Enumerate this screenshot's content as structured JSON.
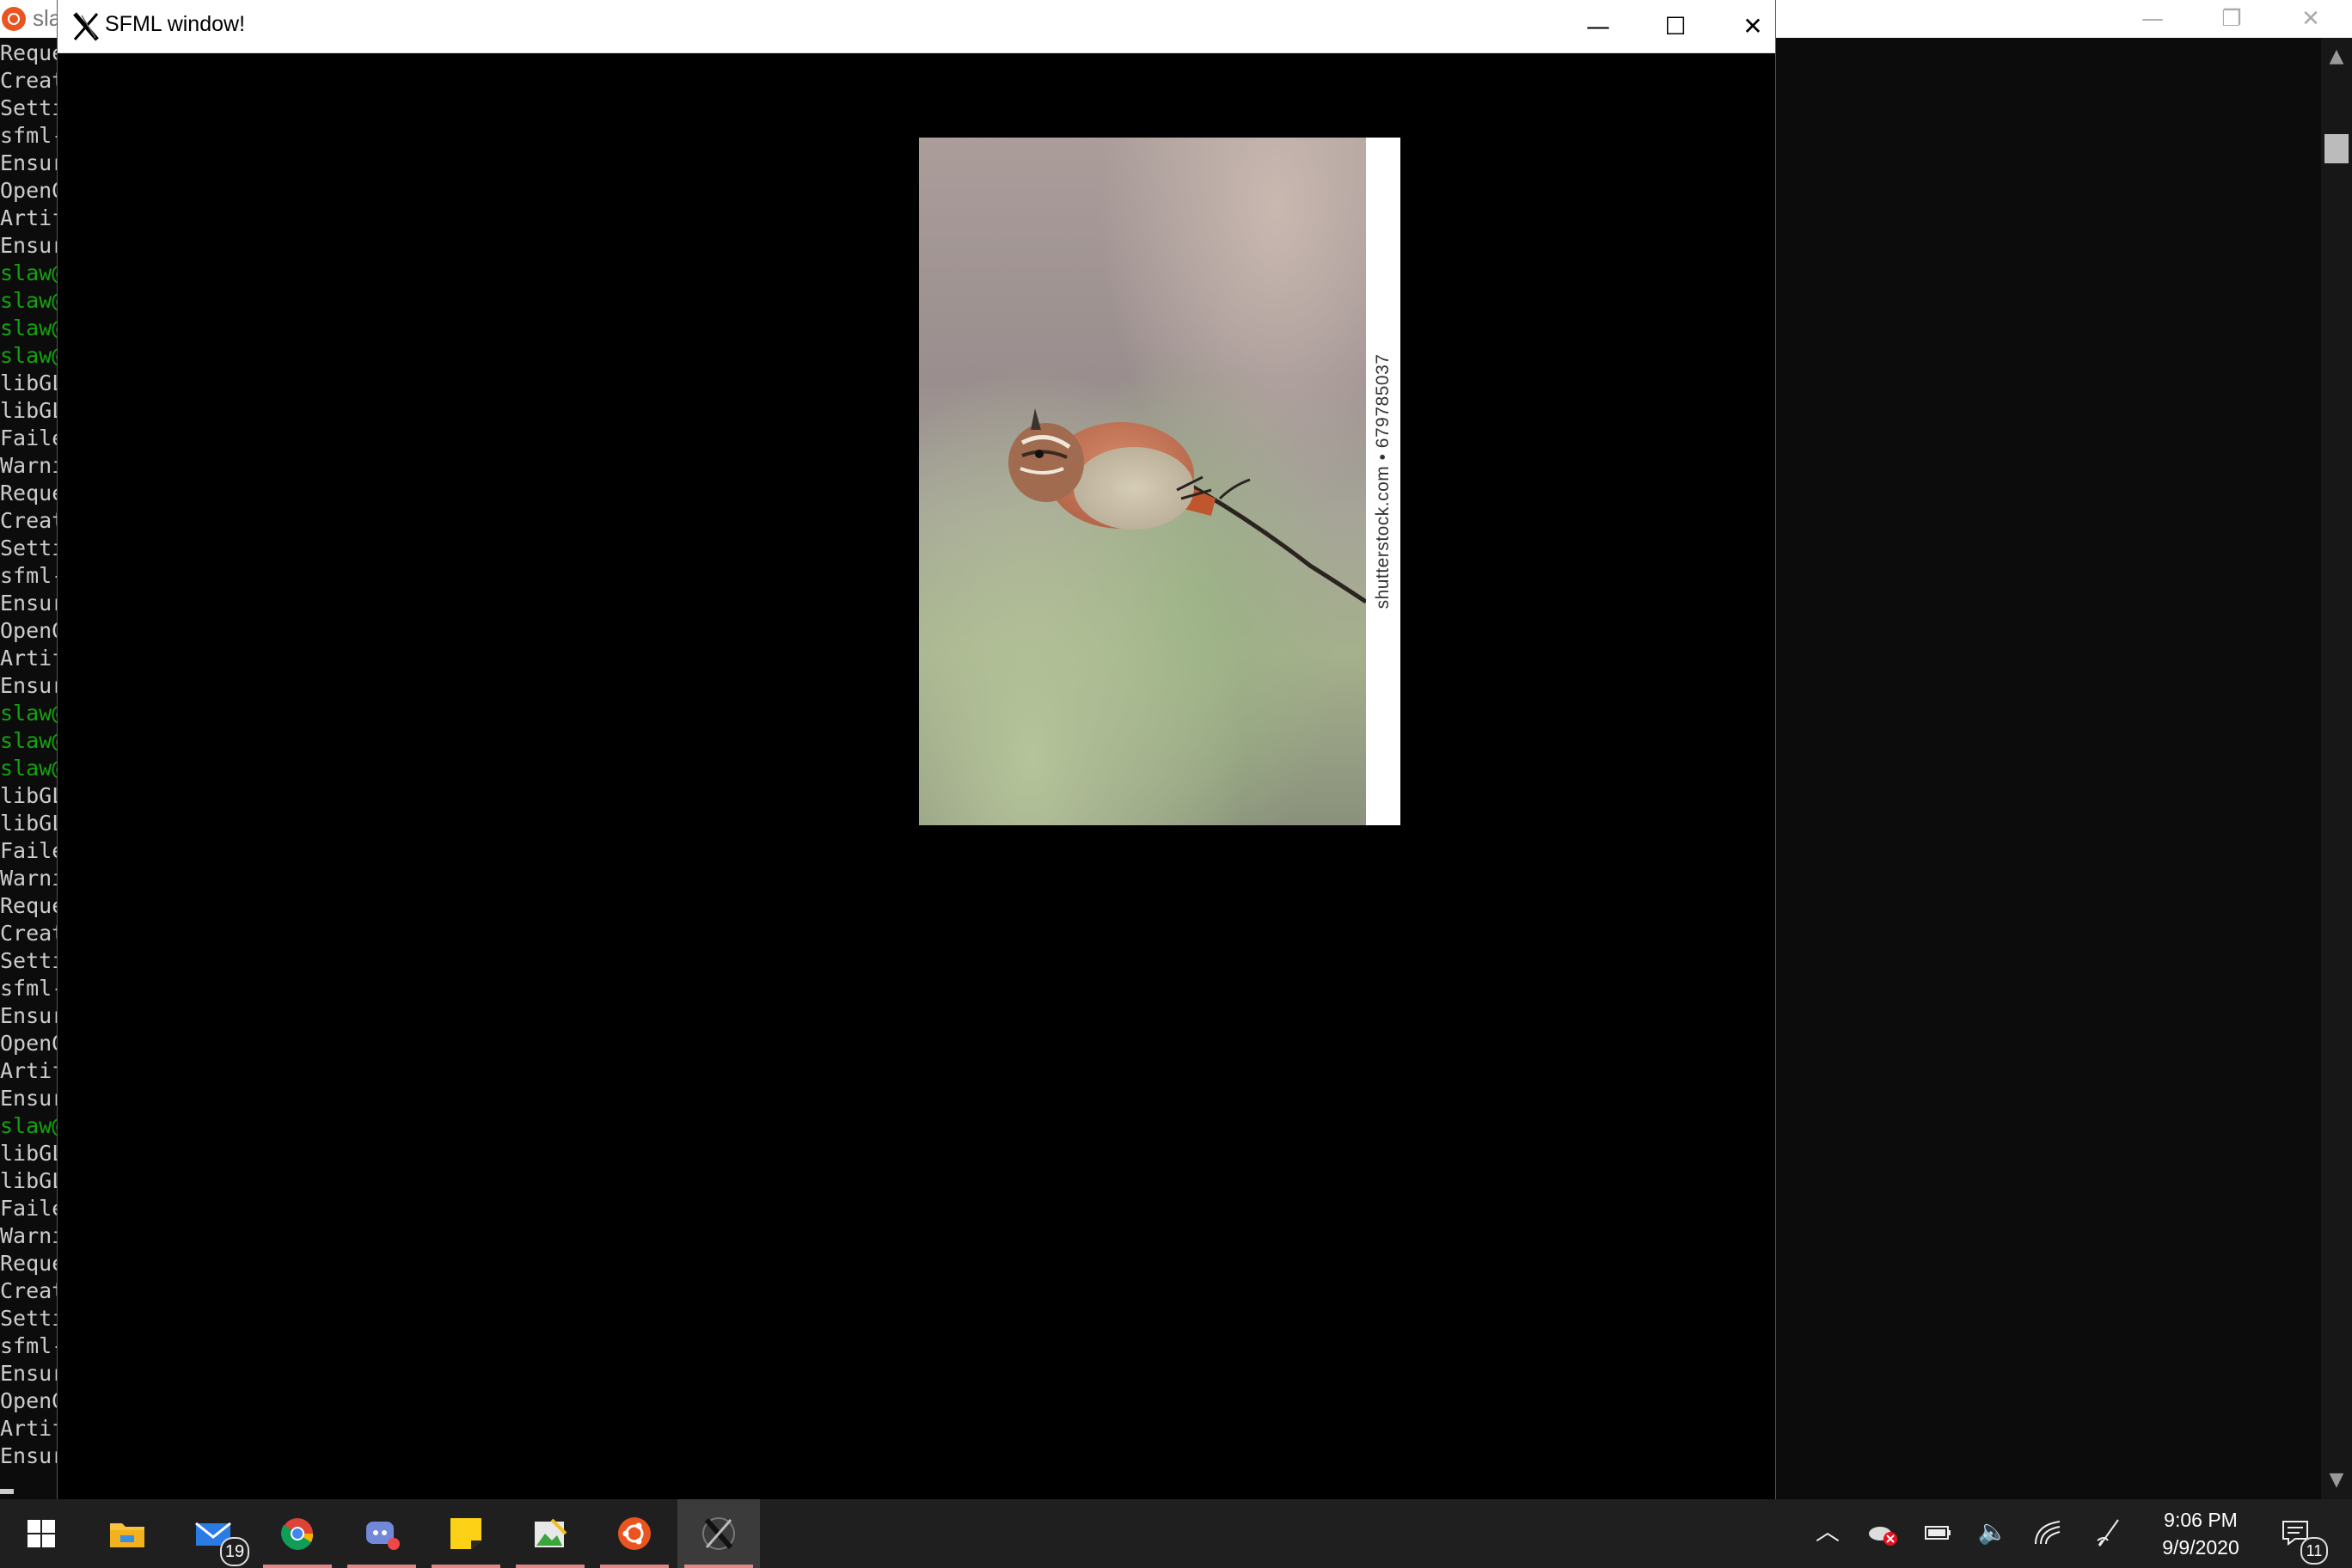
{
  "terminal": {
    "title": "sla",
    "controls": {
      "minimize": "—",
      "restore": "❐",
      "close": "✕"
    },
    "lines": [
      {
        "text": "Reque",
        "green": false
      },
      {
        "text": "Creat",
        "green": false
      },
      {
        "text": "Setti",
        "green": false
      },
      {
        "text": "sfml-",
        "green": false
      },
      {
        "text": "Ensur",
        "green": false
      },
      {
        "text": "OpenG",
        "green": false
      },
      {
        "text": "Artif",
        "green": false
      },
      {
        "text": "Ensur",
        "green": false
      },
      {
        "text": "slaw@",
        "green": true
      },
      {
        "text": "slaw@",
        "green": true
      },
      {
        "text": "slaw@",
        "green": true
      },
      {
        "text": "slaw@",
        "green": true
      },
      {
        "text": "libGL",
        "green": false
      },
      {
        "text": "libGL",
        "green": false
      },
      {
        "text": "Faile",
        "green": false
      },
      {
        "text": "Warni",
        "green": false
      },
      {
        "text": "Reque",
        "green": false
      },
      {
        "text": "Creat",
        "green": false
      },
      {
        "text": "Setti",
        "green": false
      },
      {
        "text": "sfml-",
        "green": false
      },
      {
        "text": "Ensur",
        "green": false
      },
      {
        "text": "OpenG",
        "green": false
      },
      {
        "text": "Artif",
        "green": false
      },
      {
        "text": "Ensur",
        "green": false
      },
      {
        "text": "slaw@",
        "green": true
      },
      {
        "text": "slaw@",
        "green": true
      },
      {
        "text": "slaw@",
        "green": true
      },
      {
        "text": "libGL",
        "green": false
      },
      {
        "text": "libGL",
        "green": false
      },
      {
        "text": "Faile",
        "green": false
      },
      {
        "text": "Warni",
        "green": false
      },
      {
        "text": "Reque",
        "green": false
      },
      {
        "text": "Creat",
        "green": false
      },
      {
        "text": "Setti",
        "green": false
      },
      {
        "text": "sfml-",
        "green": false
      },
      {
        "text": "Ensur",
        "green": false
      },
      {
        "text": "OpenG",
        "green": false
      },
      {
        "text": "Artif",
        "green": false
      },
      {
        "text": "Ensur",
        "green": false
      },
      {
        "text": "slaw@",
        "green": true
      },
      {
        "text": "libGL",
        "green": false
      },
      {
        "text": "libGL",
        "green": false
      },
      {
        "text": "Faile",
        "green": false
      },
      {
        "text": "Warni",
        "green": false
      },
      {
        "text": "Reque",
        "green": false
      },
      {
        "text": "Creat",
        "green": false
      },
      {
        "text": "Setti",
        "green": false
      },
      {
        "text": "sfml-",
        "green": false
      },
      {
        "text": "Ensur",
        "green": false
      },
      {
        "text": "OpenG",
        "green": false
      },
      {
        "text": "Artif",
        "green": false
      },
      {
        "text": "Ensur",
        "green": false
      }
    ]
  },
  "sfml_window": {
    "title": "SFML window!",
    "controls": {
      "minimize": "—",
      "maximize": "☐",
      "close": "✕"
    },
    "image": {
      "watermark": "shutterstock.com • 679785037"
    }
  },
  "taskbar": {
    "apps": [
      {
        "name": "file-explorer",
        "badge": ""
      },
      {
        "name": "mail",
        "badge": "19"
      },
      {
        "name": "chrome",
        "badge": ""
      },
      {
        "name": "discord",
        "badge": ""
      },
      {
        "name": "sticky-notes",
        "badge": ""
      },
      {
        "name": "image-editor",
        "badge": ""
      },
      {
        "name": "ubuntu",
        "badge": ""
      },
      {
        "name": "x-server",
        "badge": ""
      }
    ],
    "clock": {
      "time": "9:06 PM",
      "date": "9/9/2020"
    },
    "notifications_count": "11"
  },
  "colors": {
    "terminal_text": "#cccccc",
    "terminal_green": "#13a10e",
    "taskbar": "#1f1f1f",
    "underline": "#e08787",
    "ubuntu_orange": "#e95420"
  }
}
